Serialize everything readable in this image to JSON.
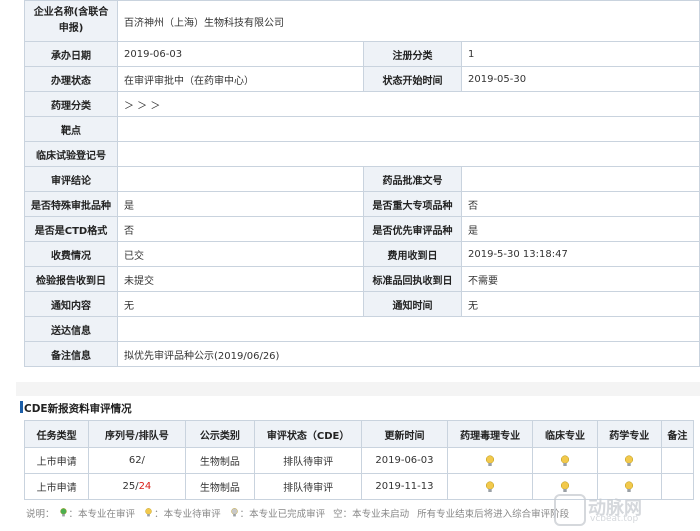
{
  "info_rows": [
    {
      "cells": [
        {
          "type": "k",
          "text": "企业名称(含联合申报)"
        },
        {
          "type": "v",
          "text": "百济神州（上海）生物科技有限公司",
          "colspan": 3
        }
      ]
    },
    {
      "cells": [
        {
          "type": "k",
          "text": "承办日期"
        },
        {
          "type": "v",
          "text": "2019-06-03"
        },
        {
          "type": "k",
          "text": "注册分类"
        },
        {
          "type": "v",
          "text": "1"
        }
      ]
    },
    {
      "cells": [
        {
          "type": "k",
          "text": "办理状态"
        },
        {
          "type": "v",
          "text": "在审评审批中（在药审中心）"
        },
        {
          "type": "k",
          "text": "状态开始时间"
        },
        {
          "type": "v",
          "text": "2019-05-30"
        }
      ]
    },
    {
      "cells": [
        {
          "type": "k",
          "text": "药理分类"
        },
        {
          "type": "v",
          "text": "＞ ＞ ＞",
          "colspan": 3
        }
      ]
    },
    {
      "cells": [
        {
          "type": "k",
          "text": "靶点"
        },
        {
          "type": "v",
          "text": "",
          "colspan": 3
        }
      ]
    },
    {
      "cells": [
        {
          "type": "k",
          "text": "临床试验登记号"
        },
        {
          "type": "v",
          "text": "",
          "colspan": 3
        }
      ]
    },
    {
      "cells": [
        {
          "type": "k",
          "text": "审评结论"
        },
        {
          "type": "v",
          "text": ""
        },
        {
          "type": "k",
          "text": "药品批准文号"
        },
        {
          "type": "v",
          "text": ""
        }
      ]
    },
    {
      "cells": [
        {
          "type": "k",
          "text": "是否特殊审批品种"
        },
        {
          "type": "v",
          "text": "是"
        },
        {
          "type": "k",
          "text": "是否重大专项品种"
        },
        {
          "type": "v",
          "text": "否"
        }
      ]
    },
    {
      "cells": [
        {
          "type": "k",
          "text": "是否是CTD格式"
        },
        {
          "type": "v",
          "text": "否"
        },
        {
          "type": "k",
          "text": "是否优先审评品种"
        },
        {
          "type": "v",
          "text": "是"
        }
      ]
    },
    {
      "cells": [
        {
          "type": "k",
          "text": "收费情况"
        },
        {
          "type": "v",
          "text": "已交"
        },
        {
          "type": "k",
          "text": "费用收到日"
        },
        {
          "type": "v",
          "text": "2019-5-30 13:18:47"
        }
      ]
    },
    {
      "cells": [
        {
          "type": "k",
          "text": "检验报告收到日"
        },
        {
          "type": "v",
          "text": "未提交"
        },
        {
          "type": "k",
          "text": "标准品回执收到日"
        },
        {
          "type": "v",
          "text": "不需要"
        }
      ]
    },
    {
      "cells": [
        {
          "type": "k",
          "text": "通知内容"
        },
        {
          "type": "v",
          "text": "无"
        },
        {
          "type": "k",
          "text": "通知时间"
        },
        {
          "type": "v",
          "text": "无"
        }
      ]
    },
    {
      "cells": [
        {
          "type": "k",
          "text": "送达信息"
        },
        {
          "type": "v",
          "text": "",
          "colspan": 3
        }
      ]
    },
    {
      "cells": [
        {
          "type": "k",
          "text": "备注信息"
        },
        {
          "type": "v",
          "text": "拟优先审评品种公示(2019/06/26)",
          "colspan": 3
        }
      ]
    }
  ],
  "cde": {
    "title": "CDE新报资料审评情况",
    "headers": [
      "任务类型",
      "序列号/排队号",
      "公示类别",
      "审评状态（CDE）",
      "更新时间",
      "药理毒理专业",
      "临床专业",
      "药学专业",
      "备注"
    ],
    "rows": [
      {
        "task": "上市申请",
        "seq": "62/",
        "seq_red": "",
        "category": "生物制品",
        "status": "排队待审评",
        "updated": "2019-06-03",
        "pharm_tox": "waiting",
        "clinical": "waiting",
        "pharmacy": "waiting",
        "note": ""
      },
      {
        "task": "上市申请",
        "seq": "25/",
        "seq_red": "24",
        "category": "生物制品",
        "status": "排队待审评",
        "updated": "2019-11-13",
        "pharm_tox": "waiting",
        "clinical": "waiting",
        "pharmacy": "waiting",
        "note": ""
      }
    ]
  },
  "legend": {
    "prefix": "说明：",
    "items": [
      {
        "icon": "green-bulb-icon",
        "text": "：本专业在审评"
      },
      {
        "icon": "yellow-bulb-icon",
        "text": "：本专业待审评"
      },
      {
        "icon": "gray-bulb-icon",
        "text": "：本专业已完成审评"
      },
      {
        "icon": "",
        "text": "空：本专业未启动"
      },
      {
        "icon": "",
        "text": "所有专业结束后将进入综合审评阶段"
      }
    ]
  },
  "watermark": {
    "brand": "动脉网",
    "site": "vcbeat.top"
  },
  "colors": {
    "header_bg": "#eef2f7",
    "border": "#c9d3de",
    "accent": "#1d5fa8",
    "queue_red": "#d9211a",
    "bulb_yellow": "#f2c94c",
    "bulb_green": "#4caf50"
  }
}
